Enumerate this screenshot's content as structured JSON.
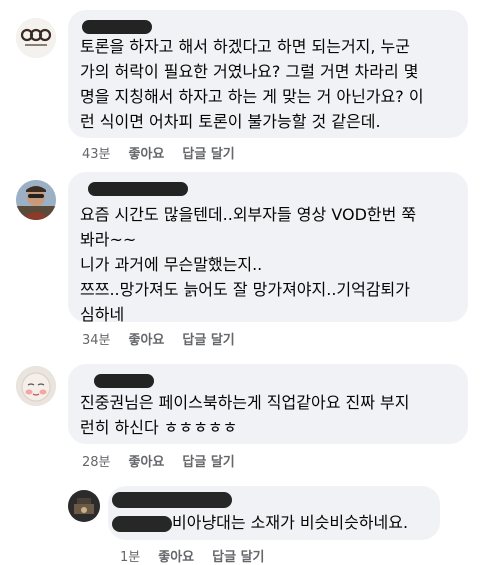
{
  "comments": [
    {
      "avatar_icon": "logo-avatar-icon",
      "author": "",
      "lines": [
        "토론을 하자고 해서 하겠다고 하면 되는거지, 누군",
        "가의 허락이 필요한 거였나요? 그럴 거면 차라리 몇",
        "명을 지칭해서 하자고 하는 게 맞는 거 아닌가요? 이",
        "런 식이면 어차피 토론이 불가능할 것 같은데."
      ],
      "time": "43분",
      "like": "좋아요",
      "reply": "답글 달기"
    },
    {
      "avatar_icon": "man-portrait-avatar-icon",
      "author": "",
      "lines": [
        "요즘 시간도 많을텐데..외부자들 영상 VOD한번 쭉",
        "봐라~~",
        "니가 과거에 무슨말했는지..",
        "쯔쯔..망가져도 늙어도 잘 망가져야지..기억감퇴가",
        "심하네"
      ],
      "time": "34분",
      "like": "좋아요",
      "reply": "답글 달기"
    },
    {
      "avatar_icon": "cartoon-face-avatar-icon",
      "author": "",
      "lines": [
        "진중권님은 페이스북하는게 직업같아요 진짜 부지",
        "런히 하신다 ㅎㅎㅎㅎㅎ"
      ],
      "time": "28분",
      "like": "좋아요",
      "reply": "답글 달기"
    }
  ],
  "reply": {
    "avatar_icon": "dark-photo-avatar-icon",
    "author": "",
    "text": "비아냥대는 소재가 비슷비슷하네요.",
    "time": "1분",
    "like": "좋아요",
    "reply": "답글 달기"
  }
}
